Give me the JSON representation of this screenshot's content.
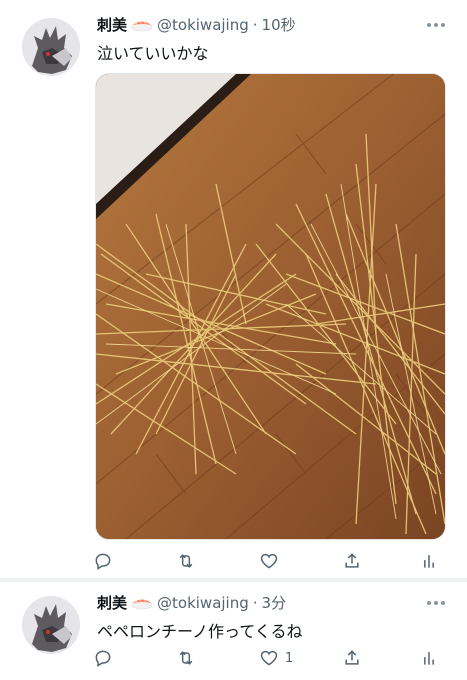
{
  "tweets": [
    {
      "display_name": "刺美",
      "name_emoji": "sushi-emoji",
      "handle": "@tokiwajing",
      "separator": "·",
      "time": "10秒",
      "text": "泣いていいかな",
      "media": {
        "description_icon": "spilled-spaghetti-photo"
      },
      "actions": {
        "reply": "",
        "retweet": "",
        "like": "",
        "share": "",
        "analytics": ""
      }
    },
    {
      "display_name": "刺美",
      "name_emoji": "sushi-emoji",
      "handle": "@tokiwajing",
      "separator": "·",
      "time": "3分",
      "text": "ペペロンチーノ作ってくるね",
      "actions": {
        "reply": "",
        "retweet": "",
        "like": "1",
        "share": "",
        "analytics": ""
      }
    }
  ],
  "colors": {
    "text": "#0f1419",
    "secondary": "#536471",
    "separator": "#eff1f3"
  }
}
